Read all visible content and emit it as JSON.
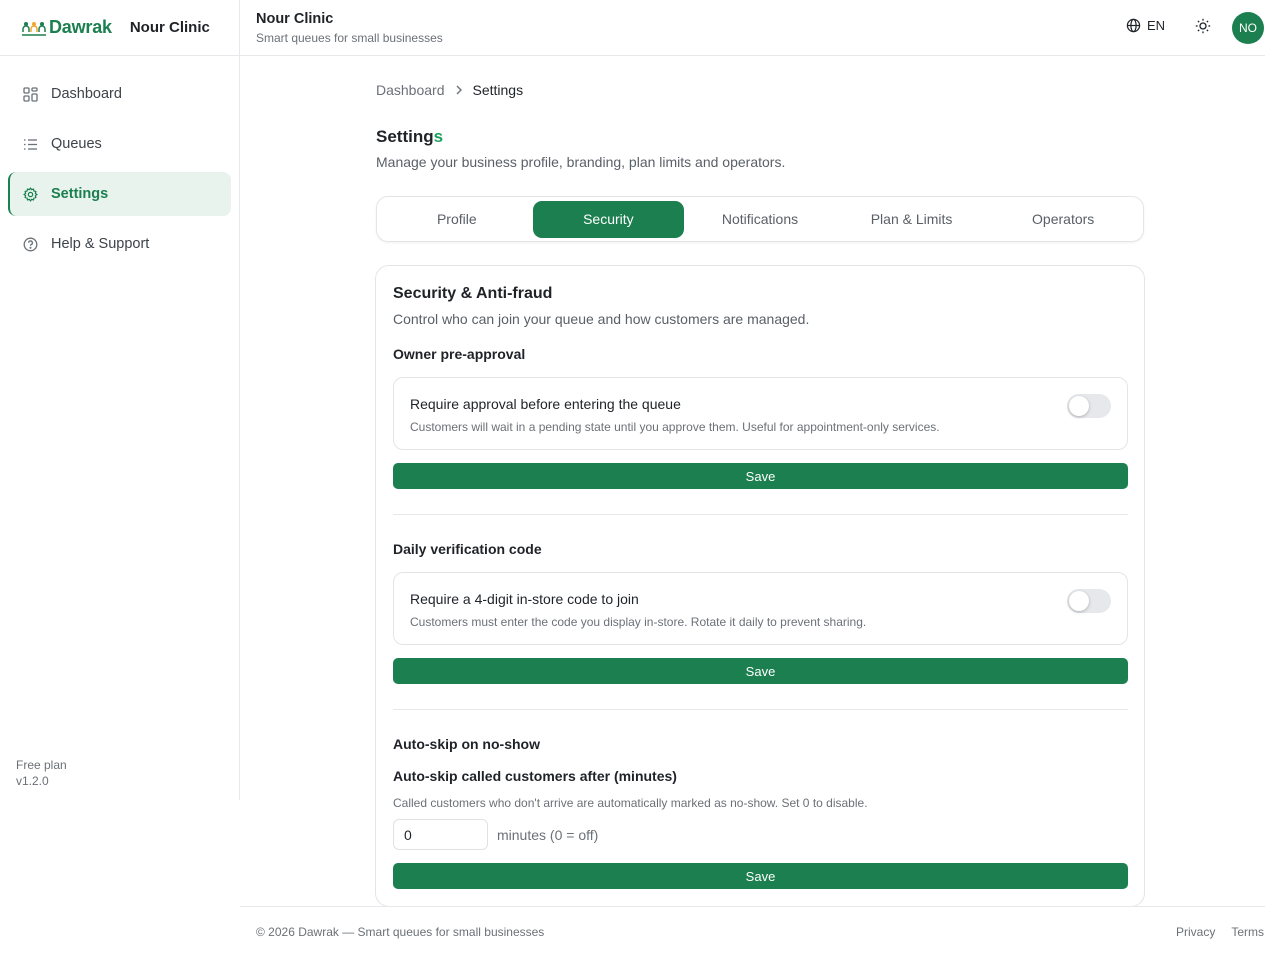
{
  "brand": {
    "logo_text": "Dawrak",
    "business_name": "Nour Clinic"
  },
  "sidebar": {
    "items": [
      {
        "label": "Dashboard",
        "icon": "dashboard-grid-icon",
        "active": false
      },
      {
        "label": "Queues",
        "icon": "list-icon",
        "active": false
      },
      {
        "label": "Settings",
        "icon": "gear-icon",
        "active": true
      },
      {
        "label": "Help & Support",
        "icon": "help-circle-icon",
        "active": false
      }
    ],
    "plan": "Free plan",
    "version": "v1.2.0"
  },
  "header": {
    "title": "Nour Clinic",
    "subtitle": "Smart queues for small businesses",
    "language": "EN",
    "avatar_initials": "NO"
  },
  "breadcrumb": {
    "parent": "Dashboard",
    "current": "Settings"
  },
  "page": {
    "title_main": "Setting",
    "title_accent": "s",
    "description": "Manage your business profile, branding, plan limits and operators."
  },
  "tabs": [
    {
      "label": "Profile",
      "active": false
    },
    {
      "label": "Security",
      "active": true
    },
    {
      "label": "Notifications",
      "active": false
    },
    {
      "label": "Plan & Limits",
      "active": false
    },
    {
      "label": "Operators",
      "active": false
    }
  ],
  "card": {
    "title": "Security & Anti-fraud",
    "description": "Control who can join your queue and how customers are managed.",
    "sections": [
      {
        "heading": "Owner pre-approval",
        "option_title": "Require approval before entering the queue",
        "option_desc": "Customers will wait in a pending state until you approve them. Useful for appointment-only services.",
        "enabled": false,
        "save_label": "Save"
      },
      {
        "heading": "Daily verification code",
        "option_title": "Require a 4-digit in-store code to join",
        "option_desc": "Customers must enter the code you display in-store. Rotate it daily to prevent sharing.",
        "enabled": false,
        "save_label": "Save"
      }
    ],
    "autoskip": {
      "heading": "Auto-skip on no-show",
      "field_label": "Auto-skip called customers after (minutes)",
      "help": "Called customers who don't arrive are automatically marked as no-show. Set 0 to disable.",
      "value": "0",
      "unit": "minutes (0 = off)",
      "save_label": "Save"
    }
  },
  "footer": {
    "text": "© 2026 Dawrak — Smart queues for small businesses",
    "links": [
      "Privacy",
      "Terms"
    ]
  },
  "colors": {
    "brand": "#1b7f4f",
    "active_bg": "#e8f3ed",
    "border": "#e2e5e8"
  }
}
